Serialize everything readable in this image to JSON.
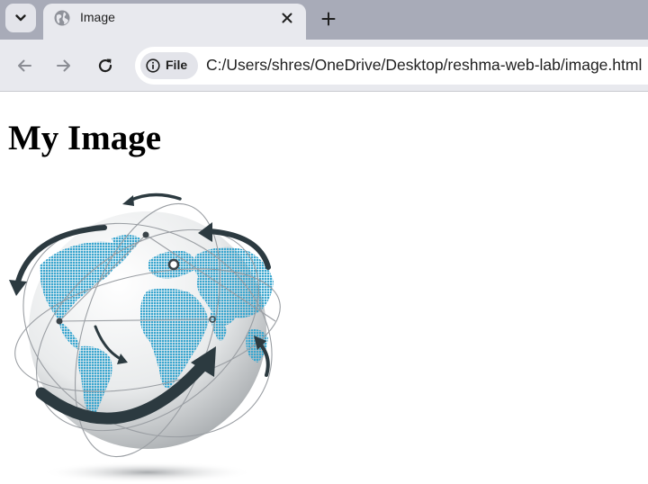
{
  "browser": {
    "tab": {
      "title": "Image"
    },
    "address_bar": {
      "chip_label": "File",
      "url": "C:/Users/shres/OneDrive/Desktop/reshma-web-lab/image.html"
    },
    "icons": {
      "tab_search": "chevron-down-icon",
      "favicon": "globe-icon",
      "close": "close-icon",
      "new_tab": "plus-icon",
      "back": "arrow-left-icon",
      "forward": "arrow-right-icon",
      "reload": "reload-icon",
      "site_info": "info-icon"
    },
    "colors": {
      "tabstrip": "#a8abb8",
      "toolbar": "#e8e9ee"
    }
  },
  "page": {
    "heading": "My Image",
    "image": {
      "description_icon": "globe-with-arrows-image",
      "colors": {
        "continents": "#3aa6cf",
        "arrows": "#2c3a40",
        "orbit": "#9a9ea3"
      }
    }
  }
}
